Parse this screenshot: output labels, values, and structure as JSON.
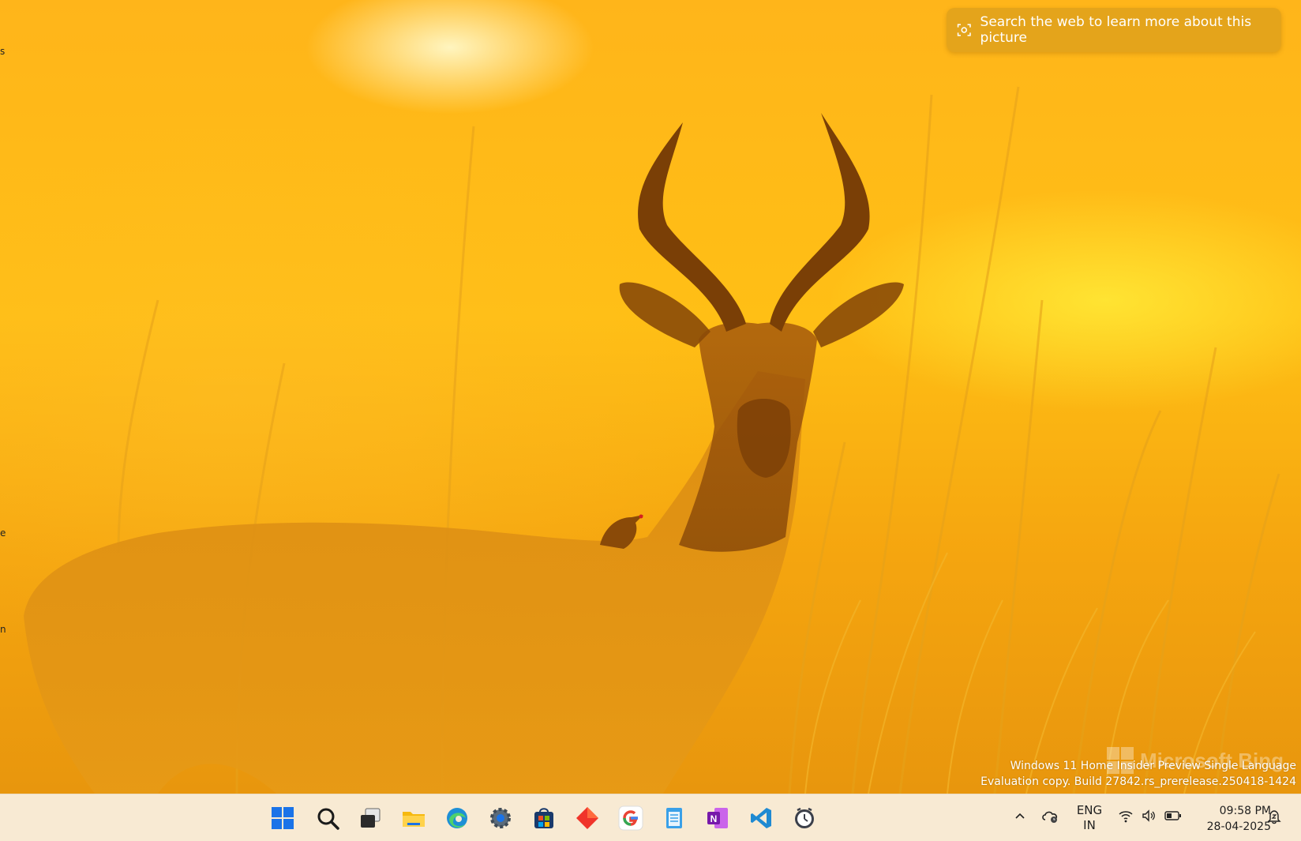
{
  "search_pill": {
    "label": "Search the web to learn more about this picture"
  },
  "watermark": {
    "line1": "Windows 11 Home Insider Preview Single Language",
    "line2": "Evaluation copy. Build 27842.rs_prerelease.250418-1424",
    "bing": "Microsoft Bing"
  },
  "taskbar": {
    "apps": [
      {
        "name": "start",
        "icon": "windows-logo-icon"
      },
      {
        "name": "search",
        "icon": "search-icon"
      },
      {
        "name": "task-view",
        "icon": "task-view-icon"
      },
      {
        "name": "file-explorer",
        "icon": "folder-icon"
      },
      {
        "name": "edge",
        "icon": "edge-icon"
      },
      {
        "name": "settings",
        "icon": "gear-icon"
      },
      {
        "name": "store",
        "icon": "store-icon"
      },
      {
        "name": "red-app",
        "icon": "diamond-icon"
      },
      {
        "name": "google",
        "icon": "google-icon"
      },
      {
        "name": "notepad",
        "icon": "notepad-icon"
      },
      {
        "name": "onenote",
        "icon": "onenote-icon"
      },
      {
        "name": "vscode",
        "icon": "vscode-icon"
      },
      {
        "name": "clock",
        "icon": "clock-app-icon"
      }
    ],
    "language": {
      "line1": "ENG",
      "line2": "IN"
    },
    "clock": {
      "time": "09:58 PM",
      "date": "28-04-2025"
    }
  },
  "colors": {
    "taskbar_bg": "#f8ead3",
    "wallpaper_main": "#ffb51a"
  }
}
